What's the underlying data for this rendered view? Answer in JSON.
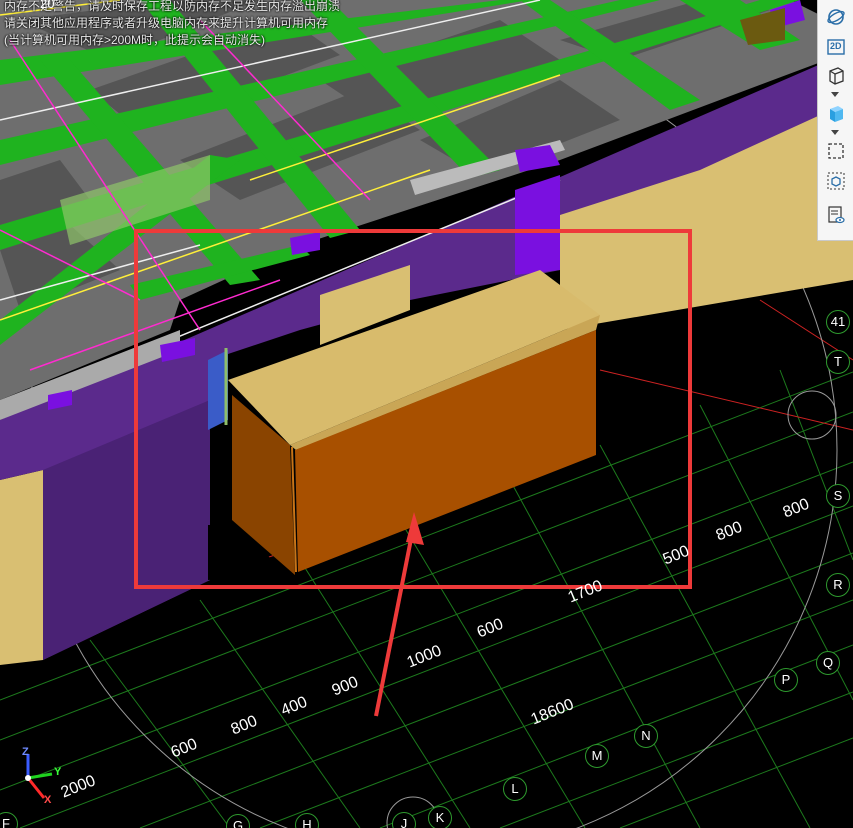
{
  "warning_lines": [
    "内存不足警告，请及时保存工程以防内存不足发生内存溢出崩溃",
    "请关闭其他应用程序或者升级电脑内存来提升计算机可用内存",
    "(当计算机可用内存>200M时，此提示会自动消失)"
  ],
  "toolbar": {
    "items": [
      {
        "name": "orbit-button",
        "icon": "orbit-icon"
      },
      {
        "name": "view-2d-button",
        "icon": "2d-view-icon",
        "label": "2D"
      },
      {
        "name": "view-3d-button",
        "icon": "cube-view-icon"
      },
      {
        "name": "shaded-view-button",
        "icon": "shaded-cube-icon"
      },
      {
        "name": "region-select-button",
        "icon": "dashed-rectangle-icon"
      },
      {
        "name": "dynamic-observe-button",
        "icon": "cube-select-icon"
      },
      {
        "name": "display-settings-button",
        "icon": "list-eye-icon"
      }
    ]
  },
  "dimensions": [
    {
      "text": "2000",
      "rot": -22
    },
    {
      "text": "600",
      "rot": -22
    },
    {
      "text": "800",
      "rot": -22
    },
    {
      "text": "400",
      "rot": -22
    },
    {
      "text": "900",
      "rot": -22
    },
    {
      "text": "1000",
      "rot": -22
    },
    {
      "text": "600",
      "rot": -22
    },
    {
      "text": "1700",
      "rot": -22
    },
    {
      "text": "500",
      "rot": -22
    },
    {
      "text": "800",
      "rot": -22
    },
    {
      "text": "800",
      "rot": -22
    },
    {
      "text": "18600",
      "rot": -22
    }
  ],
  "axis_bubbles": [
    "T",
    "S",
    "R",
    "Q",
    "P",
    "N",
    "M",
    "L",
    "K",
    "J",
    "H",
    "G",
    "F"
  ],
  "edge_label": "41",
  "top_label": "20",
  "coordinate_axes": {
    "x": "X",
    "y": "Y",
    "z": "Z"
  },
  "colors": {
    "slab_gray": "#6b6b6b",
    "beam_green": "#1fb31f",
    "wall_purple": "#5b2a8c",
    "tan": "#d9bf72",
    "cabinet_orange": "#a85000",
    "highlight_red": "#ee3a3a"
  }
}
